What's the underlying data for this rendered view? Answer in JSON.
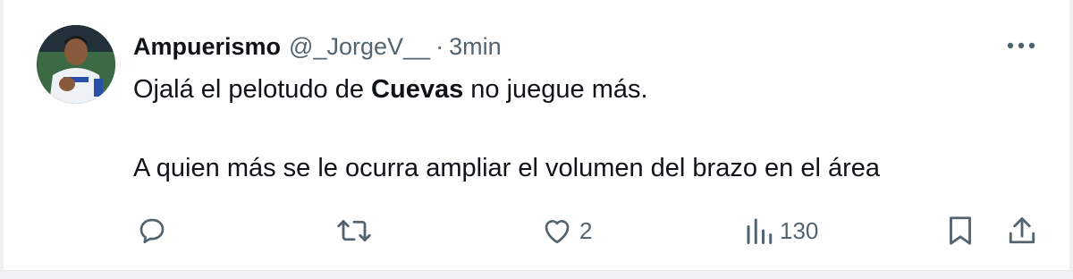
{
  "tweet": {
    "display_name": "Ampuerismo",
    "handle": "@_JorgeV__",
    "separator": "·",
    "time": "3min",
    "text_line1_before": "Ojalá el pelotudo de ",
    "text_line1_bold": "Cuevas",
    "text_line1_after": " no juegue más.",
    "text_line2": "A quien más se le ocurra ampliar el volumen del brazo en el área"
  },
  "actions": {
    "reply": {
      "icon": "reply-icon"
    },
    "retweet": {
      "icon": "retweet-icon"
    },
    "like": {
      "icon": "heart-icon",
      "count": "2"
    },
    "views": {
      "icon": "views-icon",
      "count": "130"
    },
    "bookmark": {
      "icon": "bookmark-icon"
    },
    "share": {
      "icon": "share-icon"
    }
  },
  "colors": {
    "text_primary": "#0f1419",
    "text_secondary": "#536471",
    "background": "#ffffff"
  }
}
